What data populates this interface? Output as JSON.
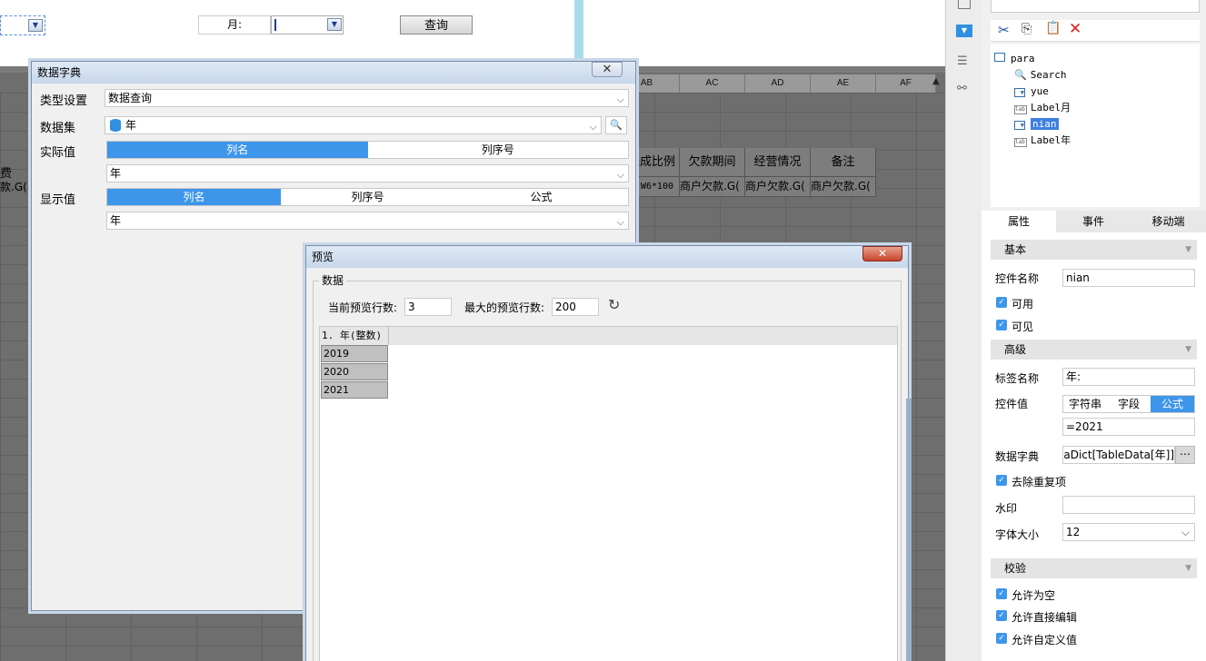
{
  "top": {
    "month_label": "月:",
    "query_button": "查询"
  },
  "sheet": {
    "columns": [
      "AB",
      "AC",
      "AD",
      "AE",
      "AF"
    ],
    "header_row": [
      "完成比例",
      "欠款期间",
      "经营情况",
      "备注"
    ],
    "left_header": "费",
    "left_value": "款.G(",
    "data_row": [
      "W6*100",
      "商户欠款.G(",
      "商户欠款.G(",
      "商户欠款.G("
    ]
  },
  "dict_dialog": {
    "title": "数据字典",
    "type_label": "类型设置",
    "type_value": "数据查询",
    "dataset_label": "数据集",
    "dataset_value": "年",
    "actual_label": "实际值",
    "actual_seg": [
      "列名",
      "列序号"
    ],
    "actual_value": "年",
    "display_label": "显示值",
    "display_seg": [
      "列名",
      "列序号",
      "公式"
    ],
    "display_value": "年"
  },
  "preview_dialog": {
    "title": "预览",
    "group": "数据",
    "current_rows_label": "当前预览行数:",
    "current_rows": "3",
    "max_rows_label": "最大的预览行数:",
    "max_rows": "200",
    "column_header": "1. 年(整数)",
    "rows": [
      "2019",
      "2020",
      "2021"
    ]
  },
  "tree": {
    "root": "para",
    "items": [
      "Search",
      "yue",
      "Label月",
      "nian",
      "Label年"
    ],
    "selected": "nian"
  },
  "tabs": [
    "属性",
    "事件",
    "移动端"
  ],
  "props": {
    "basic": "基本",
    "name_label": "控件名称",
    "name_value": "nian",
    "enabled": "可用",
    "visible": "可见",
    "advanced": "高级",
    "tag_label": "标签名称",
    "tag_value": "年:",
    "ctrl_value_label": "控件值",
    "value_seg": [
      "字符串",
      "字段",
      "公式"
    ],
    "value_formula": "=2021",
    "dict_label": "数据字典",
    "dict_value": "ataDict[TableData[年]]",
    "dedupe": "去除重复项",
    "watermark_label": "水印",
    "font_label": "字体大小",
    "font_value": "12",
    "verify": "校验",
    "allow_empty": "允许为空",
    "allow_edit": "允许直接编辑",
    "allow_custom": "允许自定义值"
  }
}
